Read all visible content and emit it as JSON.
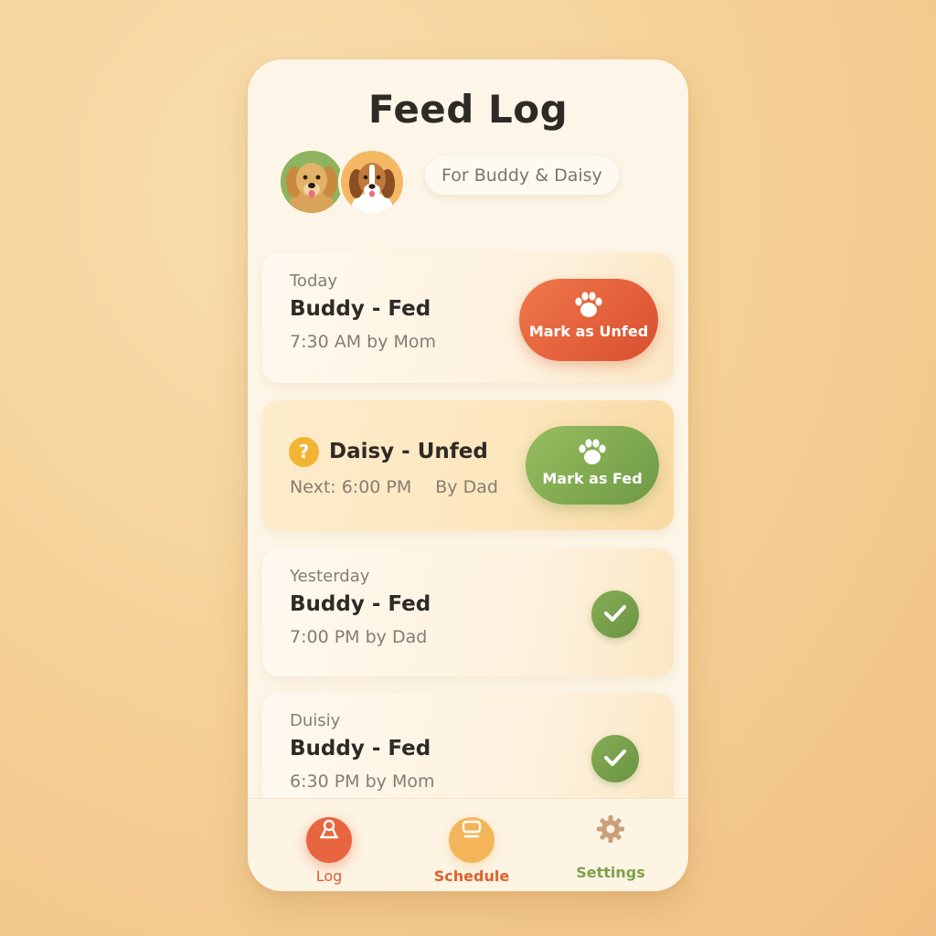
{
  "header": {
    "title": "Feed Log",
    "for_label": "For Buddy & Daisy"
  },
  "avatars": [
    {
      "icon": "golden-retriever-avatar"
    },
    {
      "icon": "beagle-avatar"
    }
  ],
  "entries": [
    {
      "label": "Today",
      "name": "Buddy - Fed",
      "meta": "7:30 AM by Mom",
      "action": "Mark as Unfed",
      "action_color": "#e0603a"
    },
    {
      "status_icon": "question-icon",
      "name": "Daisy - Unfed",
      "next": "Next: 6:00 PM",
      "by": "By Dad",
      "action": "Mark as Fed",
      "action_color": "#86ad55"
    },
    {
      "label": "Yesterday",
      "name": "Buddy - Fed",
      "meta": "7:00 PM by Dad",
      "status_icon": "check-icon"
    },
    {
      "label": "Duisiy",
      "name": "Buddy - Fed",
      "meta": "6:30 PM by Mom",
      "status_icon": "check-icon"
    }
  ],
  "tabs": [
    {
      "label": "Log",
      "icon": "log-icon",
      "color": "#e8653f",
      "active": true
    },
    {
      "label": "Schedule",
      "icon": "schedule-icon",
      "color": "#f4b55a"
    },
    {
      "label": "Settings",
      "icon": "gear-icon",
      "color": "#7ea14a"
    }
  ],
  "colors": {
    "background": "#f5cf95",
    "panel": "#fdf6e8",
    "text": "#2e2a26",
    "muted": "#857d74"
  }
}
